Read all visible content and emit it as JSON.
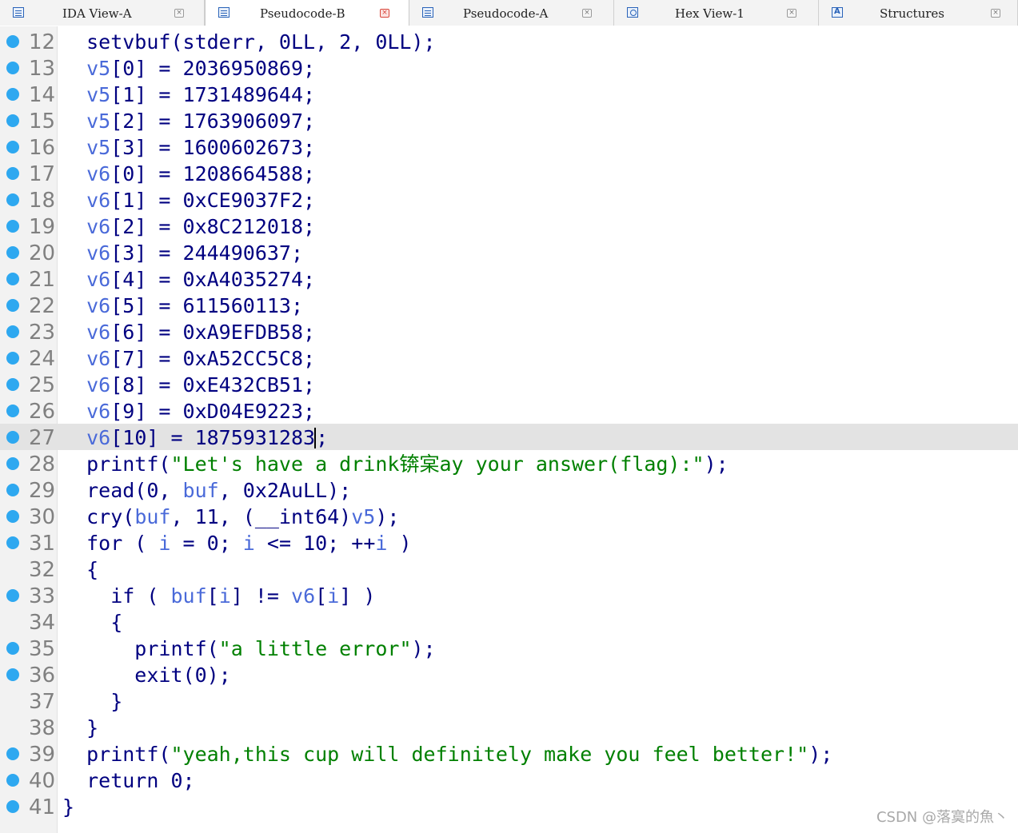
{
  "tabs": [
    {
      "label": "IDA View-A",
      "icon": "document-icon",
      "active": false
    },
    {
      "label": "Pseudocode-B",
      "icon": "document-icon",
      "active": true
    },
    {
      "label": "Pseudocode-A",
      "icon": "document-icon",
      "active": false
    },
    {
      "label": "Hex View-1",
      "icon": "hex-view-icon",
      "active": false
    },
    {
      "label": "Structures",
      "icon": "structures-icon",
      "active": false
    }
  ],
  "close_glyph": "×",
  "current_line": "27",
  "lines": [
    {
      "no": "12",
      "bp": true,
      "text": "  setvbuf(stderr, 0LL, 2, 0LL);"
    },
    {
      "no": "13",
      "bp": true,
      "text": "  v5[0] = 2036950869;"
    },
    {
      "no": "14",
      "bp": true,
      "text": "  v5[1] = 1731489644;"
    },
    {
      "no": "15",
      "bp": true,
      "text": "  v5[2] = 1763906097;"
    },
    {
      "no": "16",
      "bp": true,
      "text": "  v5[3] = 1600602673;"
    },
    {
      "no": "17",
      "bp": true,
      "text": "  v6[0] = 1208664588;"
    },
    {
      "no": "18",
      "bp": true,
      "text": "  v6[1] = 0xCE9037F2;"
    },
    {
      "no": "19",
      "bp": true,
      "text": "  v6[2] = 0x8C212018;"
    },
    {
      "no": "20",
      "bp": true,
      "text": "  v6[3] = 244490637;"
    },
    {
      "no": "21",
      "bp": true,
      "text": "  v6[4] = 0xA4035274;"
    },
    {
      "no": "22",
      "bp": true,
      "text": "  v6[5] = 611560113;"
    },
    {
      "no": "23",
      "bp": true,
      "text": "  v6[6] = 0xA9EFDB58;"
    },
    {
      "no": "24",
      "bp": true,
      "text": "  v6[7] = 0xA52CC5C8;"
    },
    {
      "no": "25",
      "bp": true,
      "text": "  v6[8] = 0xE432CB51;"
    },
    {
      "no": "26",
      "bp": true,
      "text": "  v6[9] = 0xD04E9223;"
    },
    {
      "no": "27",
      "bp": true,
      "text": "  v6[10] = 1875931283;"
    },
    {
      "no": "28",
      "bp": true,
      "text": "  printf(\"Let's have a drink锛宲ay your answer(flag):\");"
    },
    {
      "no": "29",
      "bp": true,
      "text": "  read(0, buf, 0x2AuLL);"
    },
    {
      "no": "30",
      "bp": true,
      "text": "  cry(buf, 11, (__int64)v5);"
    },
    {
      "no": "31",
      "bp": true,
      "text": "  for ( i = 0; i <= 10; ++i )"
    },
    {
      "no": "32",
      "bp": false,
      "text": "  {"
    },
    {
      "no": "33",
      "bp": true,
      "text": "    if ( buf[i] != v6[i] )"
    },
    {
      "no": "34",
      "bp": false,
      "text": "    {"
    },
    {
      "no": "35",
      "bp": true,
      "text": "      printf(\"a little error\");"
    },
    {
      "no": "36",
      "bp": true,
      "text": "      exit(0);"
    },
    {
      "no": "37",
      "bp": false,
      "text": "    }"
    },
    {
      "no": "38",
      "bp": false,
      "text": "  }"
    },
    {
      "no": "39",
      "bp": true,
      "text": "  printf(\"yeah,this cup will definitely make you feel better!\");"
    },
    {
      "no": "40",
      "bp": true,
      "text": "  return 0;"
    },
    {
      "no": "41",
      "bp": true,
      "text": "}"
    }
  ],
  "variables": [
    "v5",
    "v6",
    "buf",
    "i"
  ],
  "colors": {
    "keyword": "#000080",
    "variable": "#4a6ad9",
    "string": "#008000",
    "line_number": "#808080",
    "breakpoint": "#2ea8f0",
    "current_line_bg": "#e3e3e3"
  },
  "watermark": "CSDN @落寞的魚丶"
}
